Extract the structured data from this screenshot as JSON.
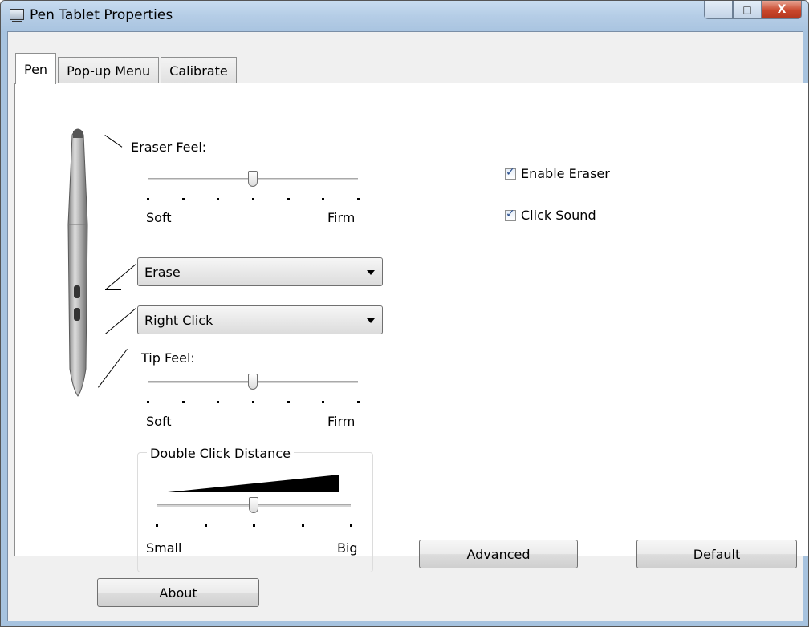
{
  "window": {
    "title": "Pen Tablet Properties",
    "controls": {
      "minimize": "—",
      "maximize": "□",
      "close": "X"
    }
  },
  "tabs": [
    {
      "label": "Pen",
      "active": true
    },
    {
      "label": "Pop-up Menu",
      "active": false
    },
    {
      "label": "Calibrate",
      "active": false
    }
  ],
  "eraser_feel": {
    "label": "Eraser Feel:",
    "min_label": "Soft",
    "max_label": "Firm",
    "value_fraction": 0.5,
    "tick_count": 7
  },
  "button_upper": {
    "value": "Erase"
  },
  "button_lower": {
    "value": "Right Click"
  },
  "tip_feel": {
    "label": "Tip Feel:",
    "min_label": "Soft",
    "max_label": "Firm",
    "value_fraction": 0.5,
    "tick_count": 7
  },
  "double_click_distance": {
    "label": "Double Click Distance",
    "min_label": "Small",
    "max_label": "Big",
    "value_fraction": 0.5,
    "tick_count": 5
  },
  "options": {
    "enable_eraser": {
      "label": "Enable Eraser",
      "checked": true
    },
    "click_sound": {
      "label": "Click Sound",
      "checked": true
    }
  },
  "buttons": {
    "advanced": "Advanced",
    "default": "Default",
    "about": "About"
  },
  "colors": {
    "title_bar": "#b5cde6",
    "close_button": "#c9472c",
    "checkmark": "#2a4f8e"
  }
}
